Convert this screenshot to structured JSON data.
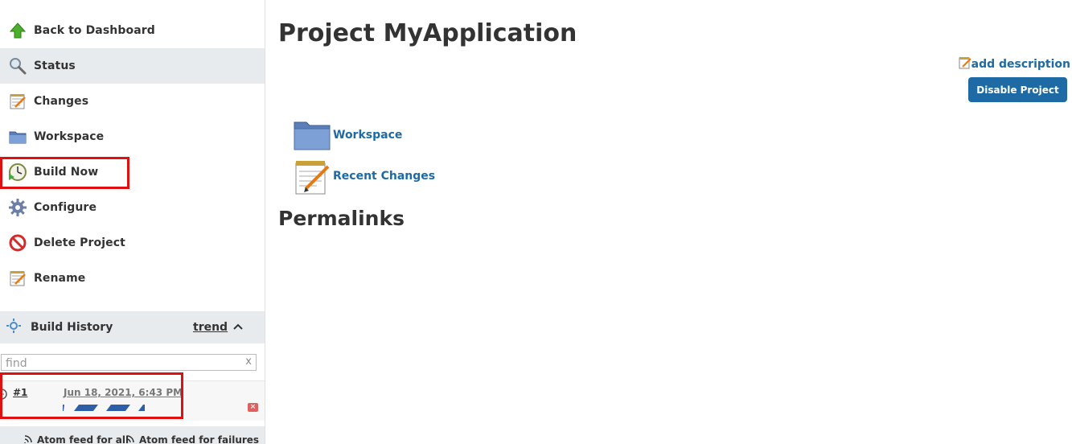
{
  "sidebar": {
    "tasks": [
      {
        "label": "Back to Dashboard",
        "icon": "up-arrow-icon"
      },
      {
        "label": "Status",
        "icon": "magnifier-icon"
      },
      {
        "label": "Changes",
        "icon": "notepad-icon"
      },
      {
        "label": "Workspace",
        "icon": "folder-icon"
      },
      {
        "label": "Build Now",
        "icon": "clock-icon"
      },
      {
        "label": "Configure",
        "icon": "gear-icon"
      },
      {
        "label": "Delete Project",
        "icon": "no-entry-icon"
      },
      {
        "label": "Rename",
        "icon": "notepad-icon"
      }
    ],
    "active_task": "Status",
    "highlighted_task": "Build Now"
  },
  "build_history": {
    "title": "Build History",
    "trend_label": "trend",
    "search_placeholder": "find",
    "clear_label": "x",
    "builds": [
      {
        "number": "#1",
        "date": "Jun 18, 2021, 6:43 PM",
        "in_progress": true
      }
    ],
    "feeds": {
      "all_label": "Atom feed for all",
      "failures_label": "Atom feed for failures"
    }
  },
  "main": {
    "title": "Project MyApplication",
    "add_description_label": "add description",
    "disable_button_label": "Disable Project",
    "links": [
      {
        "label": "Workspace",
        "icon": "folder-icon"
      },
      {
        "label": "Recent Changes",
        "icon": "notepad-icon"
      }
    ],
    "permalinks_heading": "Permalinks"
  },
  "colors": {
    "link": "#1d6aa5",
    "button": "#1d6aa5",
    "highlight": "#e01010",
    "active_bg": "#e8ebee"
  }
}
